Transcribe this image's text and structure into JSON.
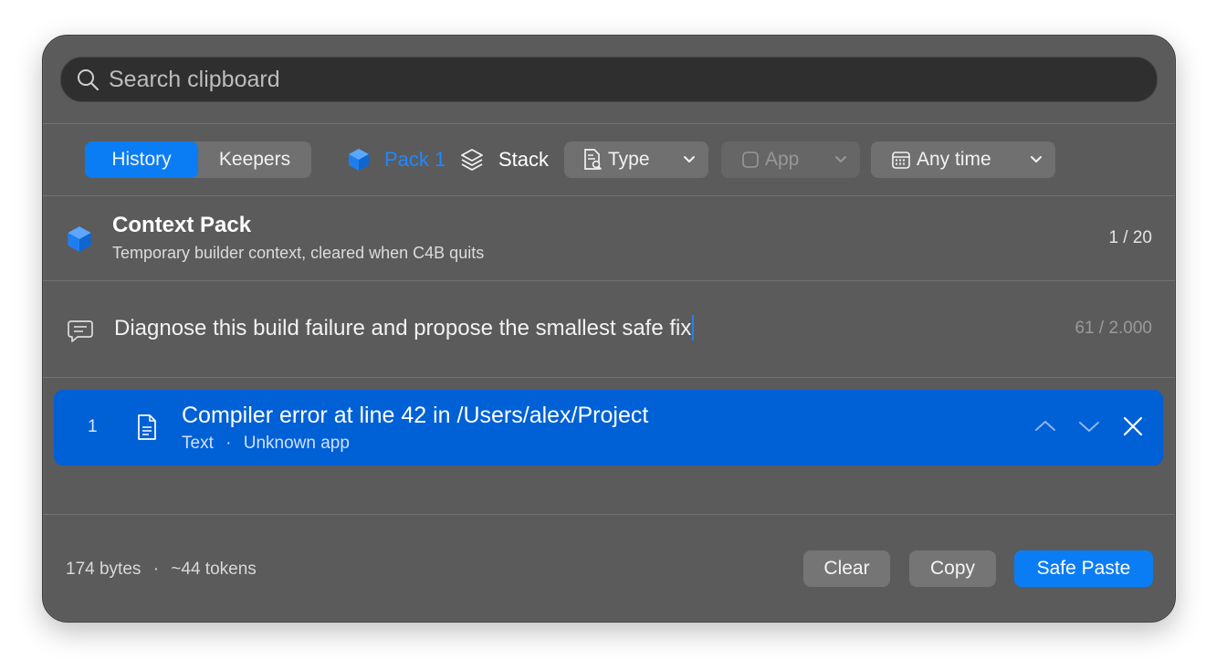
{
  "search": {
    "placeholder": "Search clipboard",
    "value": ""
  },
  "toolbar": {
    "tabs": [
      {
        "label": "History",
        "active": true
      },
      {
        "label": "Keepers",
        "active": false
      }
    ],
    "pack_label": "Pack 1",
    "stack_label": "Stack",
    "type_filter": "Type",
    "app_filter": "App",
    "time_filter": "Any time"
  },
  "context_pack": {
    "title": "Context Pack",
    "subtitle": "Temporary builder context, cleared when C4B quits",
    "count": "1 / 20"
  },
  "prompt": {
    "text": "Diagnose this build failure and propose the smallest safe fix",
    "char_count": "61 / 2.000"
  },
  "items": [
    {
      "index": "1",
      "title": "Compiler error at line 42 in /Users/alex/Project",
      "type": "Text",
      "separator": "·",
      "app": "Unknown app"
    }
  ],
  "footer": {
    "bytes": "174 bytes",
    "separator": "·",
    "tokens": "~44 tokens",
    "clear_label": "Clear",
    "copy_label": "Copy",
    "safe_paste_label": "Safe Paste"
  },
  "colors": {
    "accent": "#0a7df5",
    "selection": "#0060d6",
    "pack_blue": "#1e88ff"
  }
}
